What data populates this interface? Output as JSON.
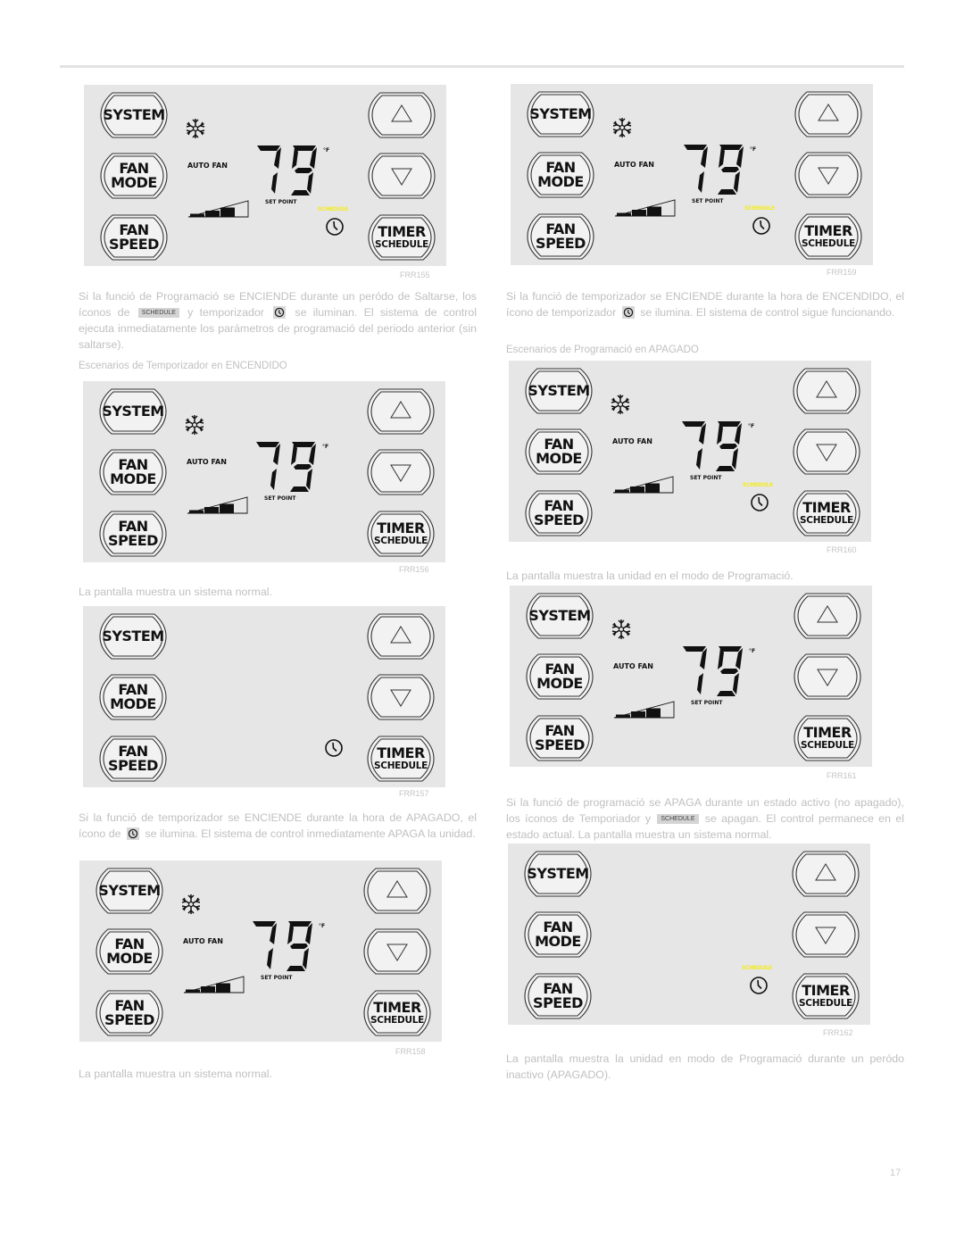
{
  "page": {
    "page_number": "17"
  },
  "panel_labels": {
    "system": "SYSTEM",
    "fan": "FAN",
    "mode": "MODE",
    "speed": "SPEED",
    "timer": "TIMER",
    "schedule": "SCHEDULE",
    "auto_fan": "AUTO FAN",
    "set_point": "SET POINT",
    "degree_unit": "°F",
    "schedule_indicator": "SCHEDULE"
  },
  "colors": {
    "panel_bg": "#e6e6e6",
    "schedule_indicator": "#f4ec1a",
    "body_text": "#c0c0c0"
  },
  "panels": [
    {
      "id": "FRR155",
      "figure_label": "FRR155",
      "temperature": "79",
      "snowflake": true,
      "auto_fan": true,
      "fan_speed_bars": 3,
      "schedule_lit": true,
      "clock": true
    },
    {
      "id": "FRR159",
      "figure_label": "FRR159",
      "temperature": "79",
      "snowflake": true,
      "auto_fan": true,
      "fan_speed_bars": 3,
      "schedule_lit": true,
      "clock": true
    },
    {
      "id": "FRR156",
      "figure_label": "FRR156",
      "temperature": "79",
      "snowflake": true,
      "auto_fan": true,
      "fan_speed_bars": 3,
      "schedule_lit": false,
      "clock": false
    },
    {
      "id": "FRR157",
      "figure_label": "FRR157",
      "temperature": "",
      "snowflake": false,
      "auto_fan": false,
      "fan_speed_bars": 0,
      "schedule_lit": false,
      "clock": true
    },
    {
      "id": "FRR158",
      "figure_label": "FRR158",
      "temperature": "79",
      "snowflake": true,
      "auto_fan": true,
      "fan_speed_bars": 3,
      "schedule_lit": false,
      "clock": false
    },
    {
      "id": "FRR160",
      "figure_label": "FRR160",
      "temperature": "79",
      "snowflake": true,
      "auto_fan": true,
      "fan_speed_bars": 3,
      "schedule_lit": true,
      "clock": true
    },
    {
      "id": "FRR161",
      "figure_label": "FRR161",
      "temperature": "79",
      "snowflake": true,
      "auto_fan": true,
      "fan_speed_bars": 3,
      "schedule_lit": false,
      "clock": false
    },
    {
      "id": "FRR162",
      "figure_label": "FRR162",
      "temperature": "",
      "snowflake": false,
      "auto_fan": false,
      "fan_speed_bars": 0,
      "schedule_lit": true,
      "clock": true
    }
  ],
  "left": {
    "para1": {
      "part1": "Si la funció de Programació se ENCIENDE durante un peródo de Saltarse, los íconos de",
      "badge": "SCHEDULE",
      "part2": "y temporizador",
      "part3": "se iluminan. El sistema de control ejecuta inmediatamente los parámetros de programació del periodo anterior (sin saltarse)."
    },
    "subheading1": "Escenarios de Temporizador en ENCENDIDO",
    "caption1": "La pantalla muestra un sistema normal.",
    "para2": {
      "part1": "Si la funció de temporizador se ENCIENDE durante la hora de APAGADO, el ícono de",
      "part2": "se ilumina. El sistema de control inmediatamente APAGA la unidad."
    },
    "caption2": "La pantalla muestra un sistema normal."
  },
  "right": {
    "para1": {
      "part1": "Si la funció de temporizador se ENCIENDE durante la hora de ENCENDIDO, el ícono de temporizador",
      "part2": "se ilumina. El sistema de control sigue funcionando."
    },
    "subheading1": "Escenarios de Programació en APAGADO",
    "caption1": "La pantalla muestra la unidad en el modo de Programació.",
    "para2": {
      "part1": "Si la funció de programació se APAGA durante un estado activo (no apagado), los íconos de Temporiador y",
      "badge": "SCHEDULE",
      "part2": "se apagan. El control permanece en el estado actual. La pantalla muestra un sistema normal."
    },
    "para3": "La pantalla muestra la unidad en modo de Programació durante un peródo inactivo (APAGADO)."
  }
}
